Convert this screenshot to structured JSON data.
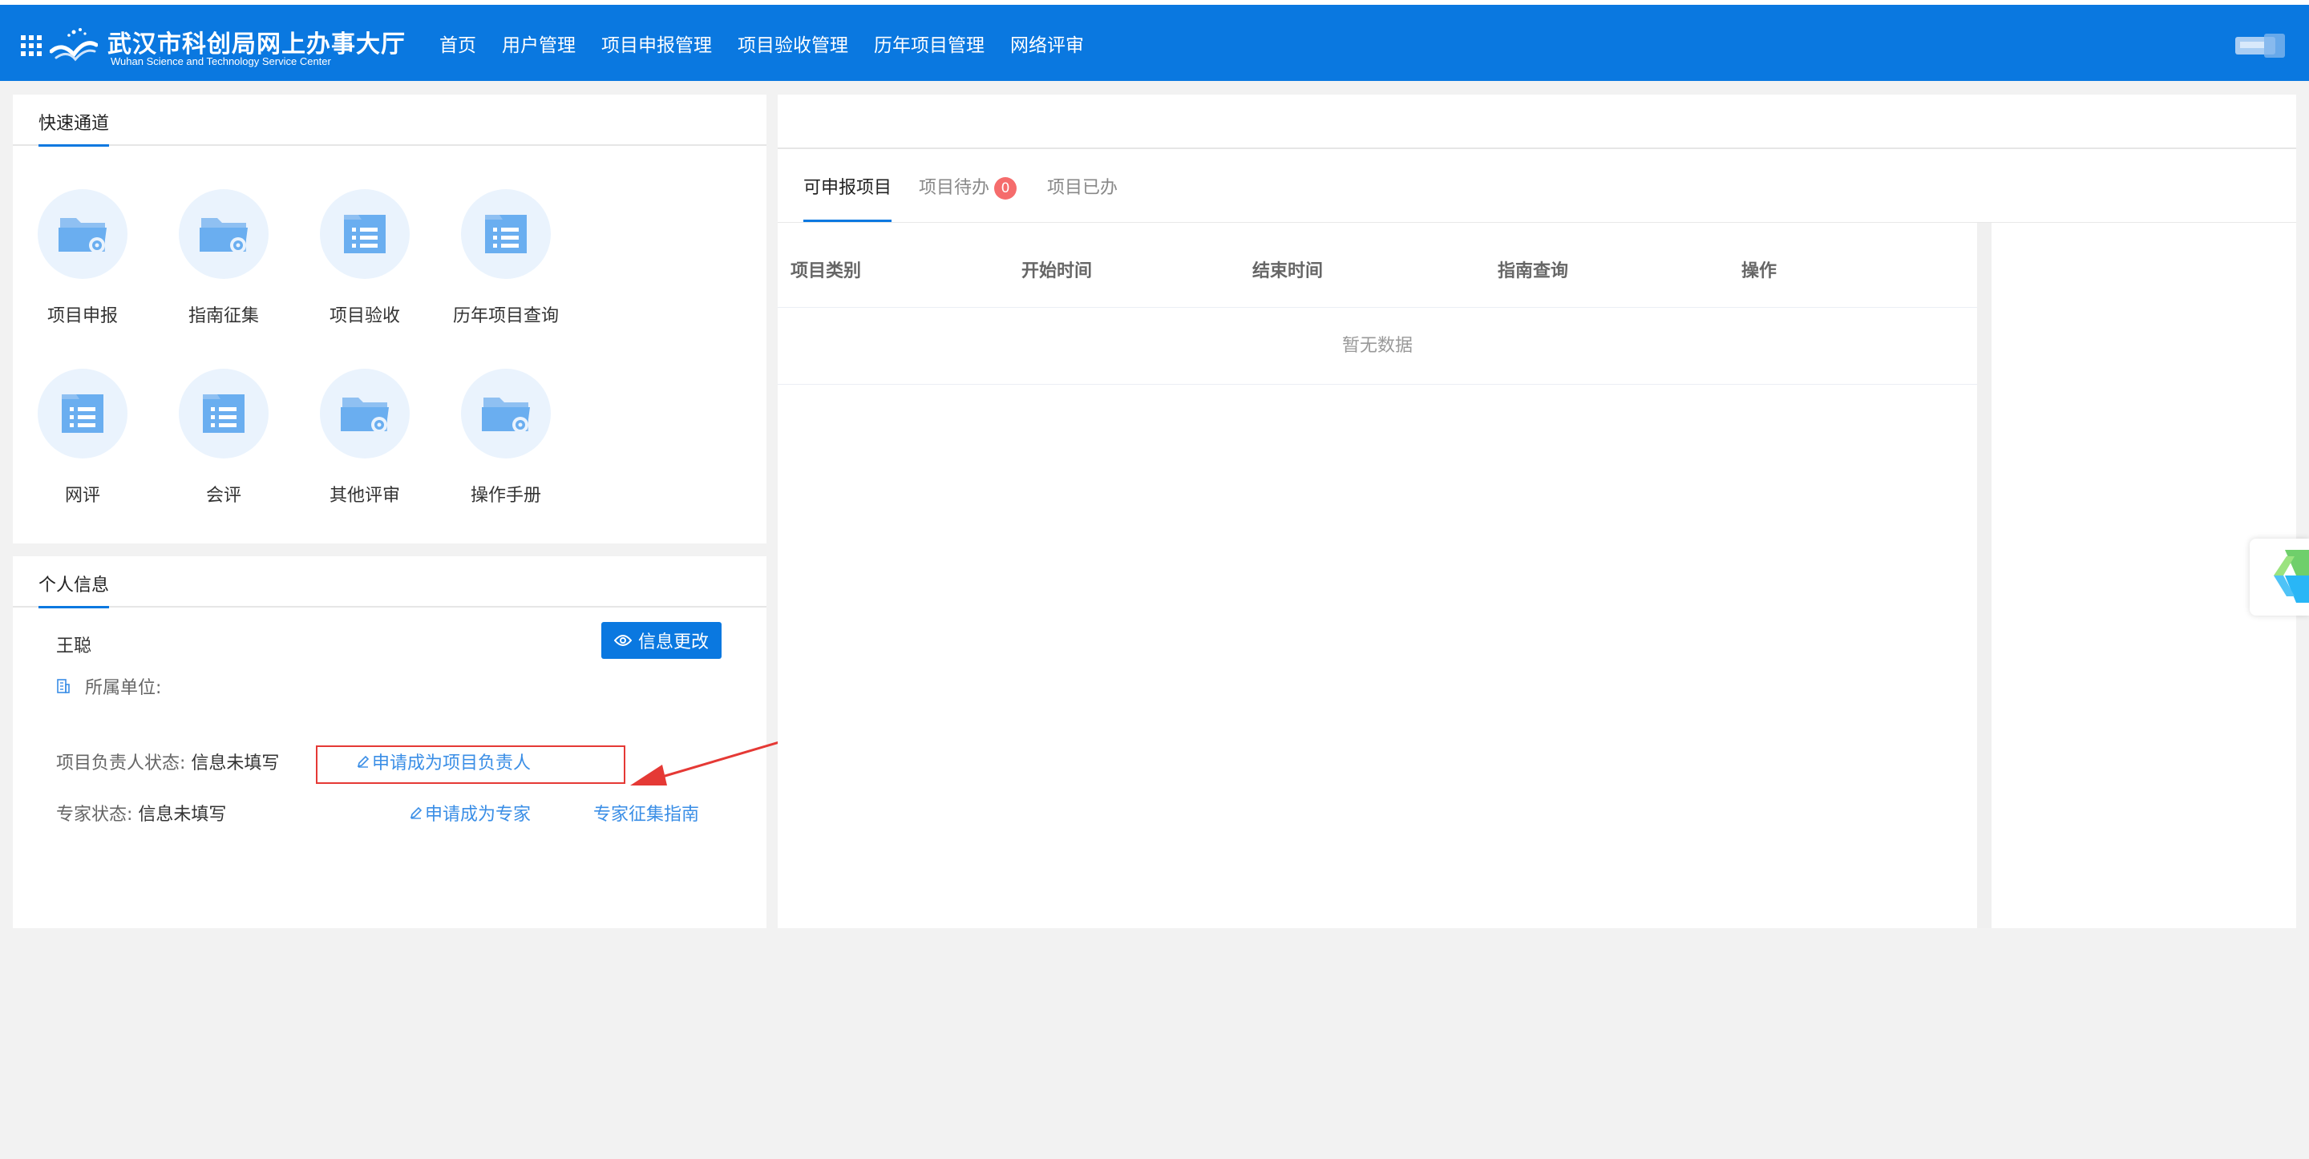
{
  "header": {
    "title": "武汉市科创局网上办事大厅",
    "subtitle": "Wuhan Science and Technology Service Center",
    "nav": [
      "首页",
      "用户管理",
      "项目申报管理",
      "项目验收管理",
      "历年项目管理",
      "网络评审"
    ]
  },
  "quick": {
    "title": "快速通道",
    "items": [
      {
        "label": "项目申报",
        "icon": "folder-gear-icon"
      },
      {
        "label": "指南征集",
        "icon": "folder-gear-icon"
      },
      {
        "label": "项目验收",
        "icon": "document-list-icon"
      },
      {
        "label": "历年项目查询",
        "icon": "document-list-icon"
      },
      {
        "label": "网评",
        "icon": "document-list-icon"
      },
      {
        "label": "会评",
        "icon": "document-list-icon"
      },
      {
        "label": "其他评审",
        "icon": "folder-gear-icon"
      },
      {
        "label": "操作手册",
        "icon": "folder-gear-icon"
      }
    ]
  },
  "info": {
    "title": "个人信息",
    "name": "王聪",
    "edit_button": "信息更改",
    "org_label": "所属单位:",
    "leader_status_label": "项目负责人状态:",
    "leader_status_value": "信息未填写",
    "leader_apply_link": "申请成为项目负责人",
    "expert_status_label": "专家状态:",
    "expert_status_value": "信息未填写",
    "expert_apply_link": "申请成为专家",
    "expert_guide_link": "专家征集指南"
  },
  "tabs": {
    "items": [
      "可申报项目",
      "项目待办",
      "项目已办"
    ],
    "todo_count": "0"
  },
  "table": {
    "columns": [
      "项目类别",
      "开始时间",
      "结束时间",
      "指南查询",
      "操作"
    ],
    "empty_text": "暂无数据"
  },
  "colors": {
    "primary": "#0a78e0",
    "link": "#3a8ee6",
    "badge": "#f56c6c",
    "highlight": "#e53935"
  }
}
